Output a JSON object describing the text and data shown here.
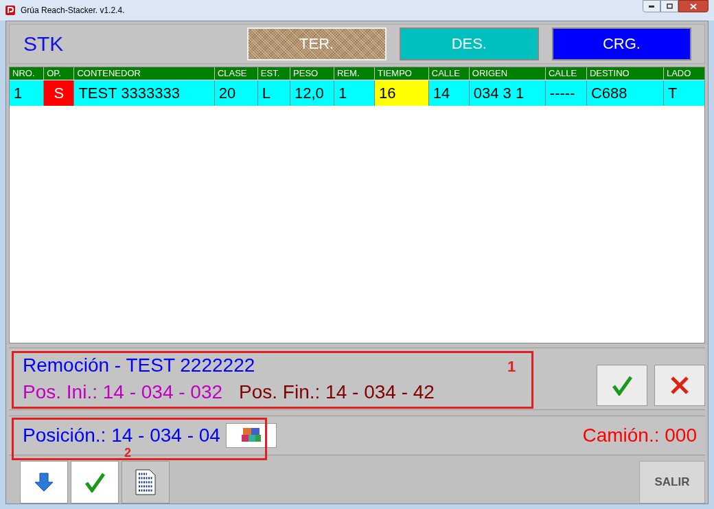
{
  "window": {
    "title": "Grúa Reach-Stacker. v1.2.4."
  },
  "header": {
    "label": "STK",
    "modes": [
      {
        "label": "TER.",
        "selected": true,
        "color": "#b8936a"
      },
      {
        "label": "DES.",
        "selected": false,
        "color": "#00bfbf"
      },
      {
        "label": "CRG.",
        "selected": false,
        "color": "#0000ff"
      }
    ]
  },
  "table": {
    "columns": [
      "NRO.",
      "OP.",
      "CONTENEDOR",
      "CLASE",
      "EST.",
      "PESO",
      "REM.",
      "TIEMPO",
      "CALLE",
      "ORIGEN",
      "CALLE",
      "DESTINO",
      "LADO"
    ],
    "rows": [
      {
        "selected": true,
        "cells": [
          {
            "text": "1"
          },
          {
            "text": "S",
            "color": "#ff0000"
          },
          {
            "text": "TEST 3333333"
          },
          {
            "text": "20"
          },
          {
            "text": "L"
          },
          {
            "text": "12,0"
          },
          {
            "text": "1"
          },
          {
            "text": "16",
            "color": "#ffff00"
          },
          {
            "text": "14"
          },
          {
            "text": "034 3 1"
          },
          {
            "text": "-----"
          },
          {
            "text": "C688"
          },
          {
            "text": "T"
          }
        ]
      }
    ]
  },
  "removal": {
    "title": "Remoción - TEST 2222222",
    "start": "Pos. Ini.: 14 - 034 - 032",
    "end": "Pos. Fin.: 14 - 034 - 42",
    "marker": "1"
  },
  "position": {
    "text": "Posición.: 14 - 034 - 04",
    "marker": "2",
    "truck": "Camión.: 000"
  },
  "toolbar": {
    "exit": "SALIR"
  }
}
